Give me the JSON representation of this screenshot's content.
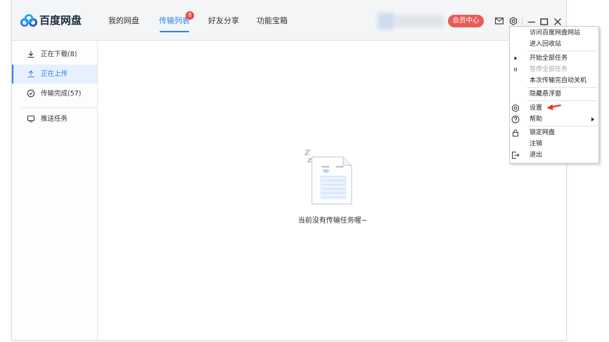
{
  "app": {
    "logo_text": "百度网盘",
    "logo_icon": "baidu-netdisk-logo-icon"
  },
  "nav": {
    "items": [
      {
        "label": "我的网盘",
        "active": false
      },
      {
        "label": "传输列表",
        "active": true,
        "badge": "8"
      },
      {
        "label": "好友分享",
        "active": false
      },
      {
        "label": "功能宝箱",
        "active": false
      }
    ]
  },
  "header": {
    "user_info_blurred": true,
    "vip_label": "会员中心",
    "icons": [
      "mail-icon",
      "gear-icon",
      "minimize-icon",
      "maximize-icon",
      "close-icon"
    ]
  },
  "sidebar": {
    "items": [
      {
        "label": "正在下载(8)",
        "icon": "download-icon",
        "active": false
      },
      {
        "label": "正在上传",
        "icon": "upload-icon",
        "active": true
      },
      {
        "label": "传输完成(57)",
        "icon": "check-circle-icon",
        "active": false
      },
      {
        "label": "推送任务",
        "icon": "monitor-icon",
        "active": false
      }
    ]
  },
  "main": {
    "empty_illustration": "sleeping-document-icon",
    "empty_text": "当前没有传输任务喔~"
  },
  "menu": {
    "items": [
      {
        "label": "访问百度网盘网站"
      },
      {
        "label": "进入回收站"
      },
      {
        "label": "开始全部任务",
        "icon": "play-icon"
      },
      {
        "label": "暂停全部任务",
        "icon": "pause-icon",
        "disabled": true
      },
      {
        "label": "本次传输完自动关机"
      },
      {
        "label": "隐藏悬浮窗"
      },
      {
        "label": "设置",
        "icon": "gear-icon",
        "annotation_icon": "red-arrow-icon"
      },
      {
        "label": "帮助",
        "icon": "help-icon",
        "submenu": true
      },
      {
        "label": "锁定网盘",
        "icon": "lock-icon"
      },
      {
        "label": "注销"
      },
      {
        "label": "退出",
        "icon": "exit-icon"
      }
    ]
  },
  "colors": {
    "accent": "#2d7cf6",
    "badge": "#f0473f",
    "vip": "#ea5a55",
    "annotation_arrow": "#e6352b",
    "active_row_bg": "#e7f0fe",
    "disabled_text": "#a8a8a8"
  }
}
